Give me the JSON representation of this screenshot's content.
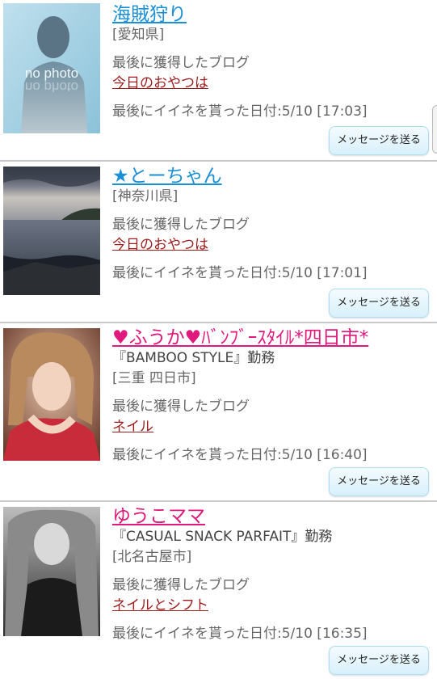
{
  "users": [
    {
      "name": "海賊狩り",
      "name_color": "blue",
      "work": "",
      "area": "[愛知県]",
      "last_blog_label": "最後に獲得したブログ",
      "blog_title": "今日のおやつは",
      "liked_date": "最後にイイネを貰った日付:5/10 [17:03]",
      "photo_text_top": "no photo",
      "photo_text_mirror": "no photo",
      "button_label": "メッセージを送る"
    },
    {
      "name": "★とーちゃん",
      "name_color": "blue",
      "work": "",
      "area": "[神奈川県]",
      "last_blog_label": "最後に獲得したブログ",
      "blog_title": "今日のおやつは",
      "liked_date": "最後にイイネを貰った日付:5/10 [17:01]",
      "button_label": "メッセージを送る"
    },
    {
      "name": "♥ふうか♥ﾊﾞﾝﾌﾞｰｽﾀｲﾙ*四日市*",
      "name_color": "pink",
      "work": "『BAMBOO STYLE』勤務",
      "area": "[三重 四日市]",
      "last_blog_label": "最後に獲得したブログ",
      "blog_title": "ネイル",
      "liked_date": "最後にイイネを貰った日付:5/10 [16:40]",
      "button_label": "メッセージを送る"
    },
    {
      "name": "ゆうこママ",
      "name_color": "pink",
      "work": "『CASUAL SNACK PARFAIT』勤務",
      "area": "[北名古屋市]",
      "last_blog_label": "最後に獲得したブログ",
      "blog_title": "ネイルとシフト",
      "liked_date": "最後にイイネを貰った日付:5/10 [16:35]",
      "button_label": "メッセージを送る"
    }
  ],
  "colors": {
    "name_blue": "#1a8fd6",
    "name_pink": "#e0197d",
    "blog_link": "#9b1c1c",
    "button_bg": "#d8f0fb"
  }
}
